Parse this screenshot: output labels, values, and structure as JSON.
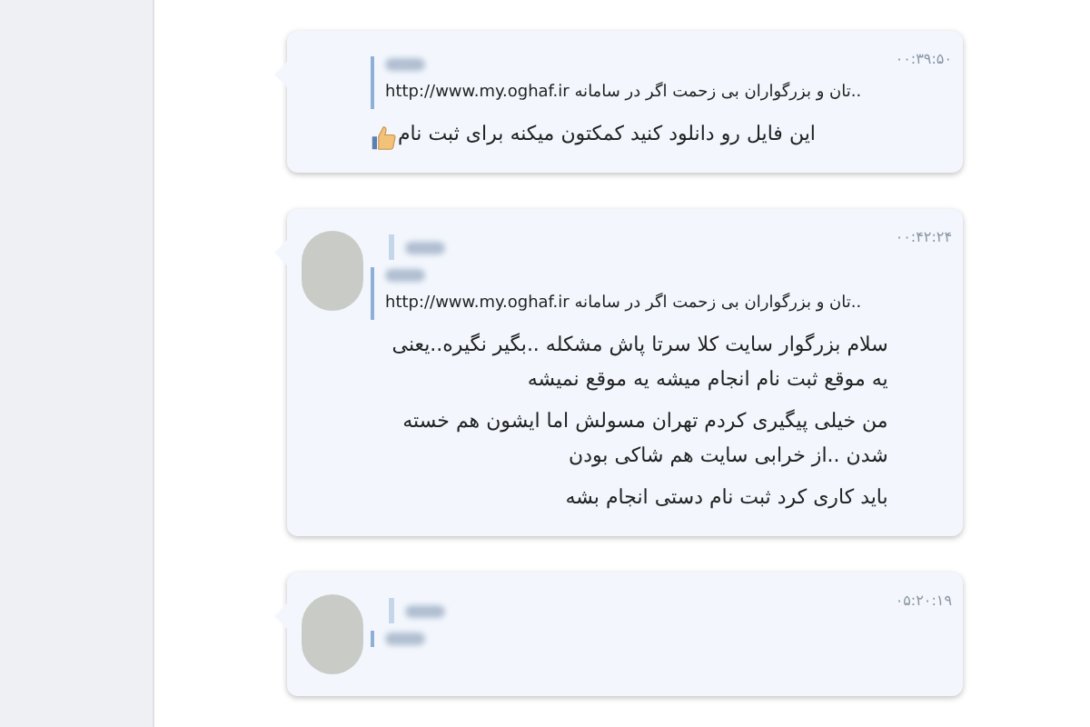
{
  "messages": [
    {
      "time": "۰۰:۳۹:۵۰",
      "avatar": false,
      "forwarded": false,
      "quote": {
        "sender_blurred": true,
        "text": "..تان و بزرگواران بی زحمت اگر در سامانه http://www.my.oghaf.ir"
      },
      "thumbs_up": true,
      "paragraphs": [
        "این فایل رو دانلود کنید کمکتون میکنه برای ثبت نام"
      ]
    },
    {
      "time": "۰۰:۴۲:۲۴",
      "avatar": true,
      "forwarded": true,
      "quote": {
        "sender_blurred": true,
        "text": "..تان و بزرگواران بی زحمت اگر در سامانه http://www.my.oghaf.ir"
      },
      "thumbs_up": false,
      "paragraphs": [
        "سلام بزرگوار سایت کلا سرتا پاش مشکله ..بگیر نگیره..یعنی یه موقع ثبت نام انجام میشه یه موقع نمیشه",
        "من خیلی پیگیری کردم تهران مسولش اما ایشون هم خسته شدن ..از خرابی سایت هم شاکی بودن",
        "باید کاری کرد ثبت نام دستی انجام بشه"
      ]
    },
    {
      "time": "۰۵:۲۰:۱۹",
      "avatar": true,
      "forwarded": true,
      "quote": {
        "sender_blurred": true
      },
      "thumbs_up": false
    }
  ]
}
